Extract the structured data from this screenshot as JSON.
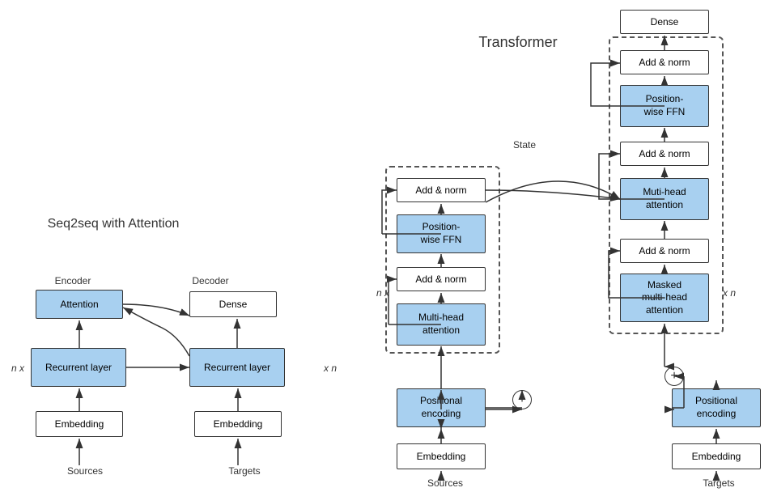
{
  "seq2seq": {
    "title": "Seq2seq with Attention",
    "encoder_label": "Encoder",
    "decoder_label": "Decoder",
    "nx_label": "n x",
    "xn_label": "x n",
    "sources_label": "Sources",
    "targets_label": "Targets",
    "boxes": {
      "attention": "Attention",
      "recurrent_enc": "Recurrent layer",
      "embedding_enc": "Embedding",
      "recurrent_dec": "Recurrent layer",
      "embedding_dec": "Embedding",
      "dense_dec": "Dense"
    }
  },
  "transformer": {
    "title": "Transformer",
    "state_label": "State",
    "nx_label": "n x",
    "xn_label": "x n",
    "sources_label": "Sources",
    "targets_label": "Targets",
    "encoder": {
      "add_norm_top": "Add & norm",
      "pos_ffn": "Position-\nwise FFN",
      "add_norm_mid": "Add & norm",
      "multi_head": "Multi-head\nattention",
      "positional": "Positional\nencoding",
      "embedding": "Embedding"
    },
    "decoder": {
      "dense": "Dense",
      "add_norm_top": "Add & norm",
      "pos_ffn": "Position-\nwise FFN",
      "add_norm_mid": "Add & norm",
      "multi_head": "Muti-head\nattention",
      "add_norm_bot": "Add & norm",
      "masked": "Masked\nmulti-head\nattention",
      "positional": "Positional\nencoding",
      "embedding": "Embedding"
    }
  }
}
